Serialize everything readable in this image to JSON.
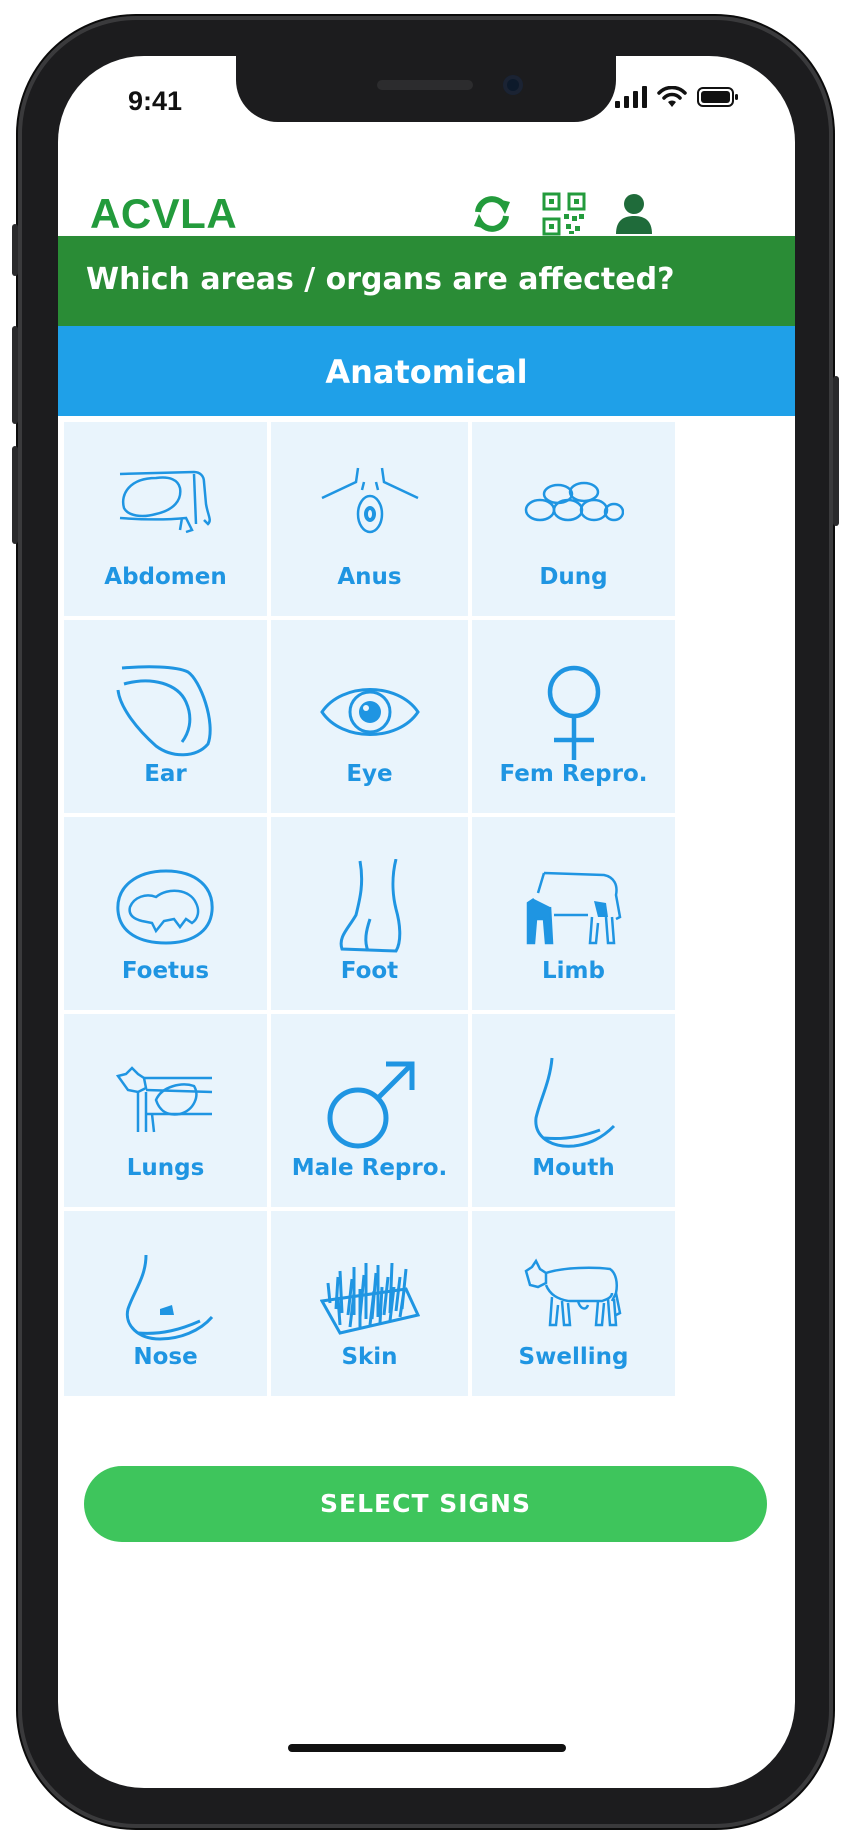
{
  "status_bar": {
    "time": "9:41"
  },
  "app_bar": {
    "logo": "ACVLA",
    "icons": [
      "sync-icon",
      "qr-code-icon",
      "user-icon"
    ],
    "brand_color": "#239b3c"
  },
  "header": {
    "question": "Which areas / organs are affected?"
  },
  "section": {
    "title": "Anatomical",
    "color": "#1fa0e8"
  },
  "areas": [
    {
      "label": "Abdomen",
      "icon": "abdomen-icon"
    },
    {
      "label": "Anus",
      "icon": "anus-icon"
    },
    {
      "label": "Dung",
      "icon": "dung-icon"
    },
    {
      "label": "Ear",
      "icon": "ear-icon"
    },
    {
      "label": "Eye",
      "icon": "eye-icon"
    },
    {
      "label": "Fem Repro.",
      "icon": "female-symbol-icon"
    },
    {
      "label": "Foetus",
      "icon": "foetus-icon"
    },
    {
      "label": "Foot",
      "icon": "foot-icon"
    },
    {
      "label": "Limb",
      "icon": "limb-icon"
    },
    {
      "label": "Lungs",
      "icon": "lungs-icon"
    },
    {
      "label": "Male Repro.",
      "icon": "male-symbol-icon"
    },
    {
      "label": "Mouth",
      "icon": "mouth-icon"
    },
    {
      "label": "Nose",
      "icon": "nose-icon"
    },
    {
      "label": "Skin",
      "icon": "skin-icon"
    },
    {
      "label": "Swelling",
      "icon": "swelling-icon"
    }
  ],
  "footer": {
    "button_label": "SELECT SIGNS",
    "button_color": "#3ec55c"
  }
}
